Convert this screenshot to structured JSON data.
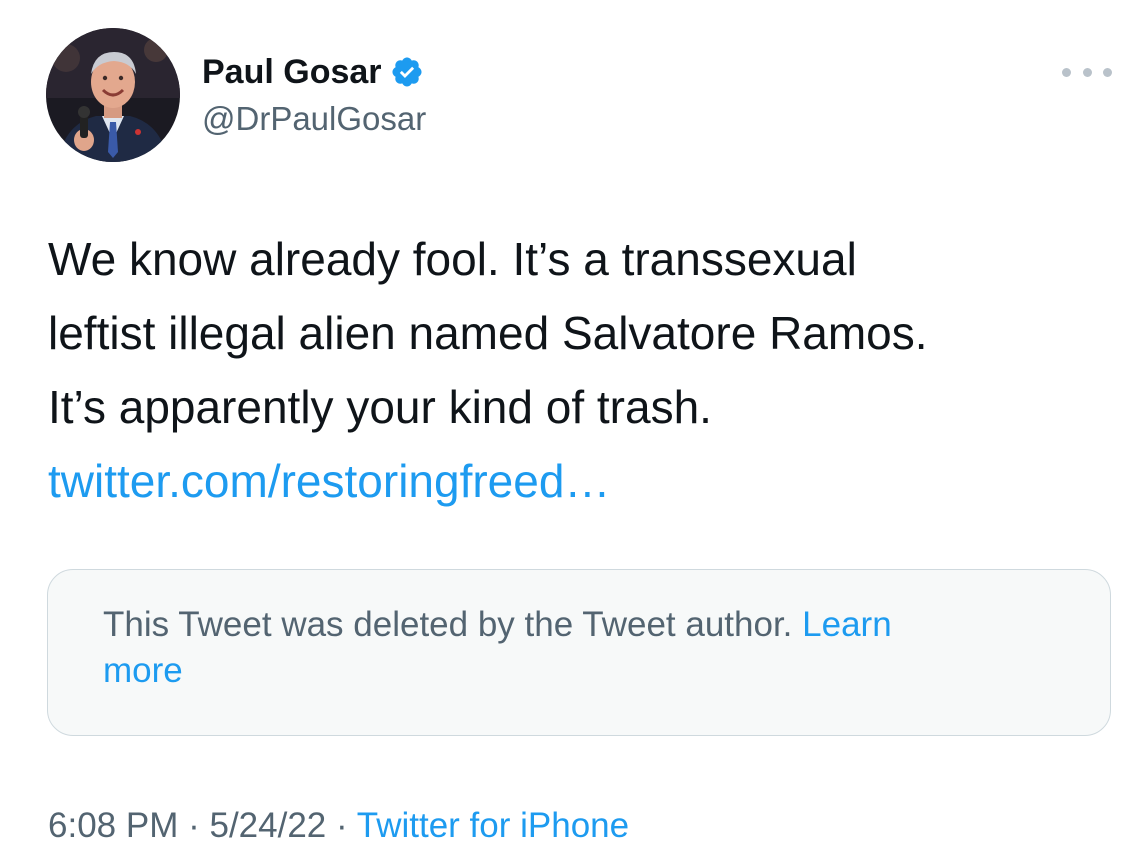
{
  "author": {
    "display_name": "Paul Gosar",
    "handle": "@DrPaulGosar",
    "verified": true,
    "avatar_icon": "profile-photo"
  },
  "tweet": {
    "text_lines": [
      "We know already fool.  It’s a transsexual",
      "leftist illegal alien named Salvatore Ramos.",
      "It’s apparently your kind of trash."
    ],
    "link": "twitter.com/restoringfreed…"
  },
  "quoted": {
    "deleted_text_line1": "This Tweet was deleted by the Tweet author.",
    "learn_more_part1": "Learn",
    "learn_more_part2": "more"
  },
  "meta": {
    "time": "6:08 PM",
    "separator": "·",
    "date": "5/24/22",
    "source": "Twitter for iPhone"
  },
  "icons": {
    "more": "more-dots-icon",
    "verified": "verified-badge-icon"
  },
  "colors": {
    "link": "#1d9bf0",
    "secondary_text": "#536471",
    "primary_text": "#0f1419",
    "card_border": "#cfd9de",
    "card_bg": "#f7f9f9"
  }
}
